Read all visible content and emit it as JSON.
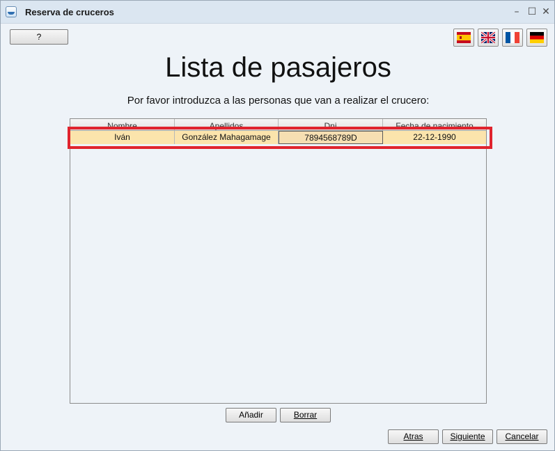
{
  "window": {
    "title": "Reserva de cruceros",
    "controls": {
      "minimize": "–",
      "maximize": "☐",
      "close": "✕"
    }
  },
  "toolbar": {
    "help_label": "?",
    "languages": [
      {
        "name": "Español",
        "icon": "spain-flag-icon"
      },
      {
        "name": "English",
        "icon": "uk-flag-icon"
      },
      {
        "name": "Français",
        "icon": "france-flag-icon"
      },
      {
        "name": "Deutsch",
        "icon": "germany-flag-icon"
      }
    ]
  },
  "main": {
    "heading": "Lista de pasajeros",
    "instruction": "Por favor introduzca a las personas que van a realizar el crucero:"
  },
  "table": {
    "columns": [
      "Nombre",
      "Apellidos",
      "Dni",
      "Fecha de nacimiento"
    ],
    "rows": [
      [
        "Iván",
        "González Mahagamage",
        "7894568789D",
        "22-12-1990"
      ]
    ]
  },
  "actions": {
    "add_label": "Añadir",
    "delete_label": "Borrar",
    "back_label": "Atras",
    "next_label": "Siguiente",
    "cancel_label": "Cancelar"
  },
  "colors": {
    "selected_row": "#fbe4ac",
    "highlight_outline": "#e0232d",
    "title_bar": "#dbe6f1"
  }
}
